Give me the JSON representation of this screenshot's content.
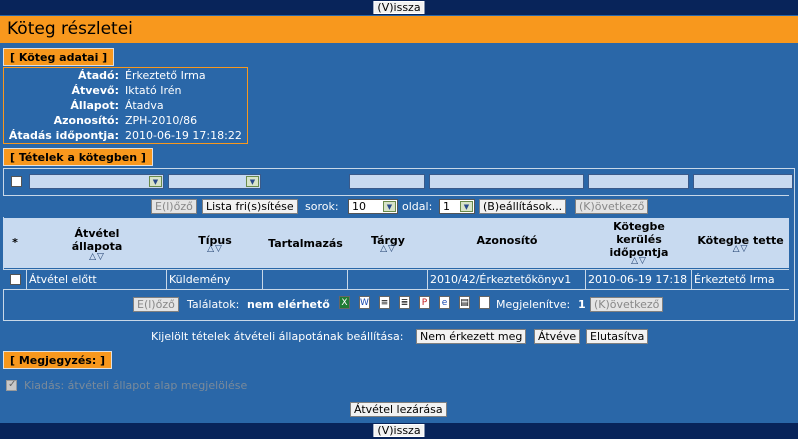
{
  "nav": {
    "back_label": "(V)issza"
  },
  "page": {
    "title": "Köteg részletei"
  },
  "bundle_section": {
    "header": "[ Köteg adatai ]",
    "fields": [
      {
        "label": "Átadó:",
        "value": "Érkeztető Irma"
      },
      {
        "label": "Átvevő:",
        "value": "Iktató Irén"
      },
      {
        "label": "Állapot:",
        "value": "Átadva"
      },
      {
        "label": "Azonosító:",
        "value": "ZPH-2010/86"
      },
      {
        "label": "Átadás időpontja:",
        "value": "2010-06-19 17:18:22"
      }
    ]
  },
  "items_section": {
    "header": "[ Tételek a kötegben ]"
  },
  "pager_top": {
    "prev": "E(l)őző",
    "refresh": "Lista fri(s)sítése",
    "rows_label": "sorok:",
    "rows_value": "10",
    "page_label": "oldal:",
    "page_value": "1",
    "settings": "(B)eállítások...",
    "next": "(K)övetkező"
  },
  "table": {
    "columns": [
      {
        "label": "*"
      },
      {
        "label": "Átvétel állapota"
      },
      {
        "label": "Típus"
      },
      {
        "label": "Tartalmazás"
      },
      {
        "label": "Tárgy"
      },
      {
        "label": "Azonosító"
      },
      {
        "label": "Kötegbe kerülés időpontja"
      },
      {
        "label": "Kötegbe tette"
      }
    ],
    "rows": [
      {
        "status": "Átvétel előtt",
        "type": "Küldemény",
        "contains": "",
        "subject": "",
        "id": "2010/42/Érkeztetőkönyv1",
        "time": "2010-06-19 17:18",
        "by": "Érkeztető Irma"
      }
    ]
  },
  "pager_bottom": {
    "prev": "E(l)őző",
    "results_label": "Találatok:",
    "results_value": "nem elérhető",
    "shown_label": "Megjelenítve:",
    "shown_value": "1",
    "next": "(K)övetkező",
    "export_icons": [
      "excel-icon",
      "word-icon",
      "rtf-icon",
      "text-icon",
      "pdf-icon",
      "html-icon",
      "print-icon",
      "blank-doc-icon"
    ]
  },
  "status_setting": {
    "label": "Kijelölt tételek átvételi állapotának beállítása:",
    "buttons": [
      "Nem érkezett meg",
      "Átvéve",
      "Elutasítva"
    ]
  },
  "comments_section": {
    "header": "[ Megjegyzés: ]",
    "checkbox_label": "Kiadás: átvételi állapot alap megjelölése"
  },
  "finalize": {
    "label": "Átvétel lezárása"
  }
}
